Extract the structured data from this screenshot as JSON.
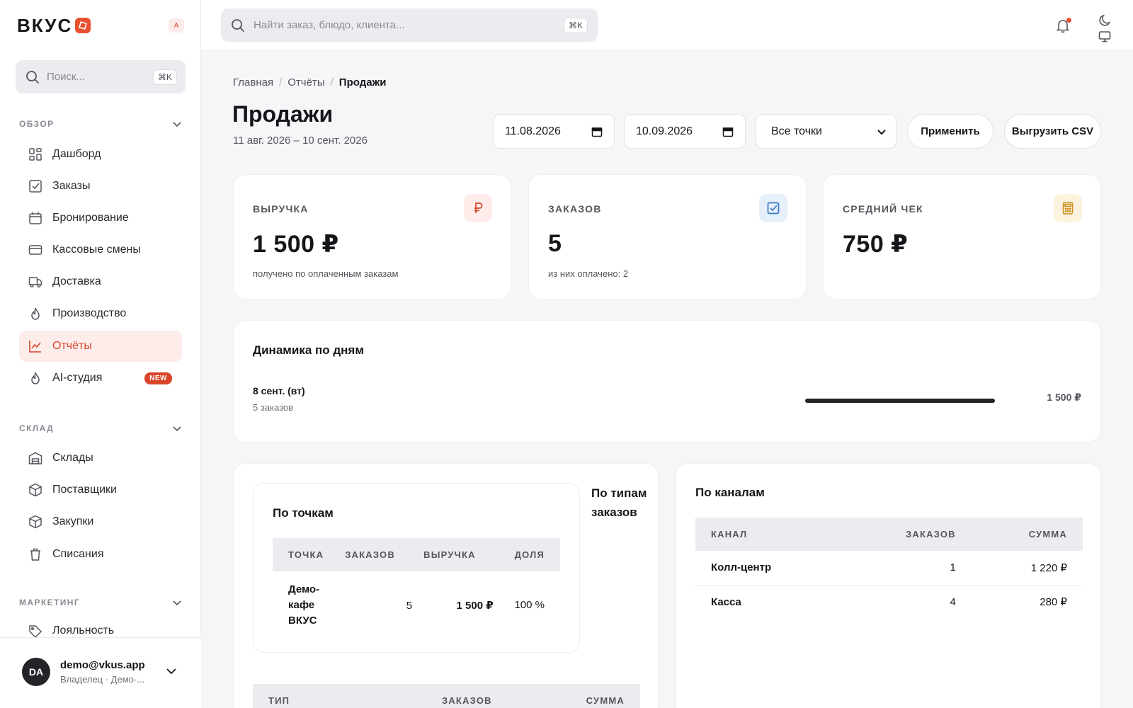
{
  "brand": {
    "name": "ВКУС",
    "lang": "A"
  },
  "sidebar": {
    "search_placeholder": "Поиск...",
    "search_shortcut": "⌘K",
    "sections": [
      {
        "title": "ОБЗОР"
      },
      {
        "title": "СКЛАД"
      },
      {
        "title": "МАРКЕТИНГ"
      }
    ],
    "overview_items": [
      {
        "label": "Дашборд",
        "icon": "dashboard-icon"
      },
      {
        "label": "Заказы",
        "icon": "checkbox-icon"
      },
      {
        "label": "Бронирование",
        "icon": "calendar-icon"
      },
      {
        "label": "Кассовые смены",
        "icon": "card-icon"
      },
      {
        "label": "Доставка",
        "icon": "truck-icon"
      },
      {
        "label": "Производство",
        "icon": "flame-icon"
      },
      {
        "label": "Отчёты",
        "icon": "chart-icon",
        "active": true
      },
      {
        "label": "AI-студия",
        "icon": "flame-icon",
        "badge": "NEW"
      }
    ],
    "warehouse_items": [
      {
        "label": "Склады",
        "icon": "warehouse-icon"
      },
      {
        "label": "Поставщики",
        "icon": "box-icon"
      },
      {
        "label": "Закупки",
        "icon": "box-icon"
      },
      {
        "label": "Списания",
        "icon": "trash-icon"
      }
    ],
    "marketing_items": [
      {
        "label": "Лояльность",
        "icon": "tag-icon"
      }
    ],
    "user": {
      "initials": "DA",
      "email": "demo@vkus.app",
      "role": "Владелец · Демо-..."
    }
  },
  "topbar": {
    "search_placeholder": "Найти заказ, блюдо, клиента...",
    "search_shortcut": "⌘K"
  },
  "breadcrumb": [
    "Главная",
    "Отчёты",
    "Продажи"
  ],
  "page": {
    "title": "Продажи",
    "subtitle": "11 авг. 2026 – 10 сент. 2026"
  },
  "filters": {
    "date_from": "11.08.2026",
    "date_to": "10.09.2026",
    "point": "Все точки",
    "apply_label": "Применить",
    "export_label": "Выгрузить CSV"
  },
  "kpis": [
    {
      "label": "ВЫРУЧКА",
      "value": "1 500 ₽",
      "note": "получено по оплаченным заказам",
      "icon": "ruble-icon",
      "color": "#d8452a",
      "bg": "#fdecea"
    },
    {
      "label": "ЗАКАЗОВ",
      "value": "5",
      "note": "из них оплачено: 2",
      "icon": "checkbox-icon",
      "color": "#3a78c2",
      "bg": "#e6f0fb"
    },
    {
      "label": "СРЕДНИЙ ЧЕК",
      "value": "750 ₽",
      "note": "",
      "icon": "calculator-icon",
      "color": "#c9901a",
      "bg": "#fcf3df"
    }
  ],
  "daily": {
    "title": "Динамика по дням",
    "rows": [
      {
        "day": "8 сент. (вт)",
        "orders": "5 заказов",
        "sum": "1 500 ₽",
        "share": 1.0
      }
    ]
  },
  "by_points": {
    "title": "По точкам",
    "headers": [
      "ТОЧКА",
      "ЗАКАЗОВ",
      "ВЫРУЧКА",
      "ДОЛЯ"
    ],
    "rows": [
      {
        "point": "Демо-кафе ВКУС",
        "orders": "5",
        "revenue": "1 500 ₽",
        "share": "100 %"
      }
    ]
  },
  "by_types": {
    "title": "По типам заказов",
    "headers": [
      "ТИП",
      "ЗАКАЗОВ",
      "СУММА"
    ]
  },
  "by_channels": {
    "title": "По каналам",
    "headers": [
      "КАНАЛ",
      "ЗАКАЗОВ",
      "СУММА"
    ],
    "rows": [
      {
        "channel": "Колл-центр",
        "orders": "1",
        "sum": "1 220 ₽"
      },
      {
        "channel": "Касса",
        "orders": "4",
        "sum": "280 ₽"
      }
    ]
  },
  "colors": {
    "accent": "#d8452a",
    "dark": "#232328"
  }
}
